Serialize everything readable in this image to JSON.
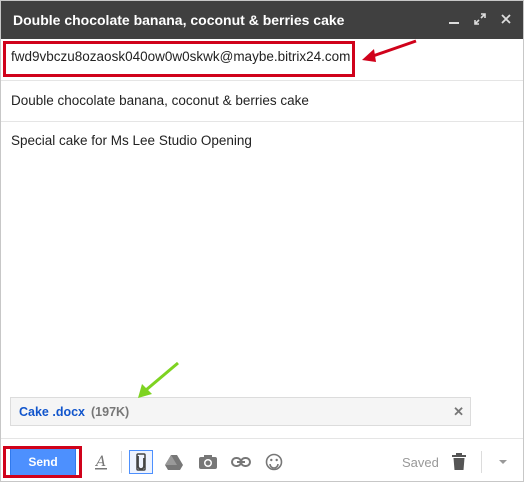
{
  "window": {
    "title": "Double chocolate banana, coconut & berries cake"
  },
  "compose": {
    "to": "fwd9vbczu8ozaosk040ow0w0skwk@maybe.bitrix24.com",
    "subject": "Double chocolate banana, coconut & berries cake",
    "body": "Special cake for Ms Lee Studio Opening"
  },
  "attachment": {
    "name": "Cake .docx",
    "size": "(197K)"
  },
  "toolbar": {
    "send_label": "Send",
    "saved_label": "Saved"
  },
  "colors": {
    "titlebar": "#404040",
    "send": "#4d90fe",
    "highlight_red": "#d0021b",
    "arrow_green": "#7ed321",
    "link": "#1155cc"
  },
  "icons": [
    "minimize-icon",
    "popout-icon",
    "close-icon",
    "formatting-icon",
    "attach-icon",
    "drive-icon",
    "photo-icon",
    "link-icon",
    "emoji-icon",
    "trash-icon",
    "more-options-icon"
  ]
}
